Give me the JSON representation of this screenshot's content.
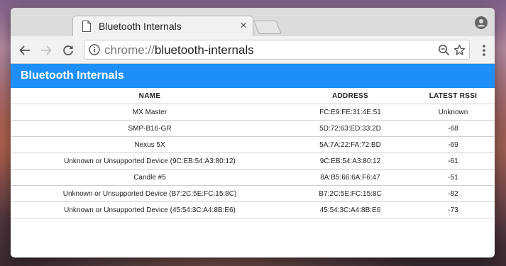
{
  "browser": {
    "tab": {
      "title": "Bluetooth Internals",
      "close": "×"
    },
    "address_bar": {
      "scheme": "chrome://",
      "host": "bluetooth-internals"
    }
  },
  "page": {
    "title": "Bluetooth Internals",
    "accent_color": "#1e8ff8",
    "table": {
      "headers": [
        "NAME",
        "ADDRESS",
        "LATEST RSSI"
      ],
      "rows": [
        [
          "MX Master",
          "FC:E9:FE:31:4E:51",
          "Unknown"
        ],
        [
          "SMP-B16-GR",
          "5D:72:63:ED:33:2D",
          "-68"
        ],
        [
          "Nexus 5X",
          "5A:7A:22:FA:72:BD",
          "-69"
        ],
        [
          "Unknown or Unsupported Device (9C:EB:54:A3:80:12)",
          "9C:EB:54:A3:80:12",
          "-61"
        ],
        [
          "Candle #5",
          "8A:B5:66:6A:F6:47",
          "-51"
        ],
        [
          "Unknown or Unsupported Device (B7:2C:5E:FC:15:8C)",
          "B7:2C:5E:FC:15:8C",
          "-82"
        ],
        [
          "Unknown or Unsupported Device (45:54:3C:A4:8B:E6)",
          "45:54:3C:A4:8B:E6",
          "-73"
        ]
      ]
    }
  },
  "icons": [
    "page-icon",
    "close-icon",
    "profile-icon",
    "back-arrow-icon",
    "forward-arrow-icon",
    "reload-icon",
    "info-icon",
    "zoom-out-icon",
    "bookmark-star-icon",
    "menu-dots-icon"
  ]
}
